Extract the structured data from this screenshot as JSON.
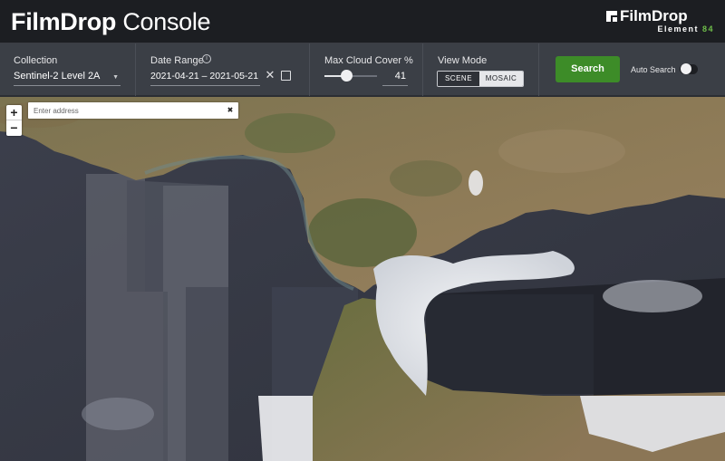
{
  "header": {
    "title_bold": "FilmDrop",
    "title_light": "Console",
    "brand_name": "FilmDrop",
    "brand_sub_text": "Element",
    "brand_sub_num": "84",
    "logo_icon": "filmdrop-logo-icon"
  },
  "toolbar": {
    "collection": {
      "label": "Collection",
      "value": "Sentinel-2 Level 2A",
      "caret": "▼"
    },
    "date_range": {
      "label": "Date Range",
      "info_glyph": "i",
      "value": "2021-04-21 – 2021-05-21",
      "clear_glyph": "✕"
    },
    "cloud_cover": {
      "label": "Max Cloud Cover %",
      "value": "41",
      "fraction": 0.41
    },
    "view_mode": {
      "label": "View Mode",
      "options": [
        "SCENE",
        "MOSAIC"
      ],
      "selected": "MOSAIC"
    },
    "search": {
      "label": "Search"
    },
    "auto_search": {
      "label": "Auto Search",
      "enabled": false
    }
  },
  "map": {
    "zoom_in": "+",
    "zoom_out": "−",
    "address": {
      "placeholder": "Enter address",
      "value": "",
      "clear_glyph": "✖"
    }
  },
  "colors": {
    "header_bg": "#1c1e22",
    "toolbar_bg": "#3b3f46",
    "search_green": "#3d8c28",
    "brand_accent": "#6fbf4a",
    "land": "#8a7a55",
    "land_green": "#5f6a3c",
    "sea": "#353845",
    "cloud": "#e9ebee"
  }
}
